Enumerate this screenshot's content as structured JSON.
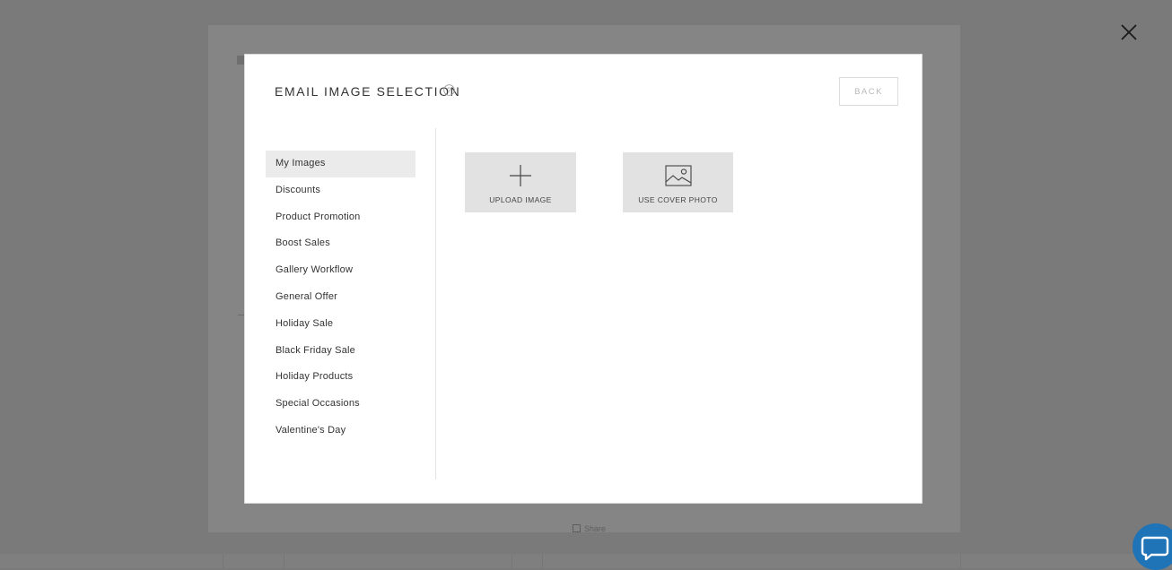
{
  "modal": {
    "title": "EMAIL IMAGE SELECTION",
    "back_label": "BACK",
    "help_icon": "question-circle-icon"
  },
  "sidebar": {
    "items": [
      {
        "label": "My Images",
        "active": true
      },
      {
        "label": "Discounts",
        "active": false
      },
      {
        "label": "Product Promotion",
        "active": false
      },
      {
        "label": "Boost Sales",
        "active": false
      },
      {
        "label": "Gallery Workflow",
        "active": false
      },
      {
        "label": "General Offer",
        "active": false
      },
      {
        "label": "Holiday Sale",
        "active": false
      },
      {
        "label": "Black Friday Sale",
        "active": false
      },
      {
        "label": "Holiday Products",
        "active": false
      },
      {
        "label": "Special Occasions",
        "active": false
      },
      {
        "label": "Valentine's Day",
        "active": false
      }
    ]
  },
  "tiles": {
    "upload": {
      "label": "UPLOAD IMAGE",
      "icon": "plus-icon"
    },
    "cover": {
      "label": "USE COVER PHOTO",
      "icon": "image-icon"
    }
  },
  "overlay": {
    "close_icon": "close-icon"
  },
  "underlay": {
    "footer_text": "Share"
  },
  "chat": {
    "icon": "chat-bubble-icon",
    "color": "#1f73b7"
  }
}
